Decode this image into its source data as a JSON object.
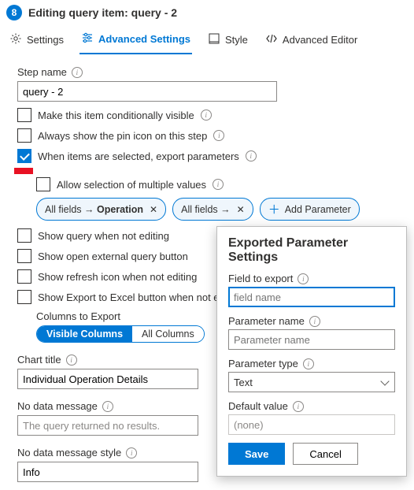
{
  "header": {
    "step_number": "8",
    "title": "Editing query item: query - 2"
  },
  "tabs": {
    "settings": "Settings",
    "advanced": "Advanced Settings",
    "style": "Style",
    "advanced_editor": "Advanced Editor"
  },
  "form": {
    "step_name_label": "Step name",
    "step_name_value": "query - 2",
    "cb_cond_visible": "Make this item conditionally visible",
    "cb_pin_icon": "Always show the pin icon on this step",
    "cb_export_params": "When items are selected, export parameters",
    "cb_multi_values": "Allow selection of multiple values",
    "pill1_prefix": "All fields → ",
    "pill1_bold": "Operation",
    "pill2_text": "All fields →",
    "pill_add": "Add Parameter",
    "cb_show_query": "Show query when not editing",
    "cb_open_external": "Show open external query button",
    "cb_refresh": "Show refresh icon when not editing",
    "cb_export_excel": "Show Export to Excel button when not editing",
    "columns_export_label": "Columns to Export",
    "seg_visible": "Visible Columns",
    "seg_all": "All Columns",
    "chart_title_label": "Chart title",
    "chart_title_value": "Individual Operation Details",
    "no_data_label": "No data message",
    "no_data_value": "The query returned no results.",
    "no_data_style_label": "No data message style",
    "no_data_style_value": "Info"
  },
  "popup": {
    "title": "Exported Parameter Settings",
    "field_export_label": "Field to export",
    "field_export_placeholder": "field name",
    "param_name_label": "Parameter name",
    "param_name_placeholder": "Parameter name",
    "param_type_label": "Parameter type",
    "param_type_value": "Text",
    "default_value_label": "Default value",
    "default_value_value": "(none)",
    "save": "Save",
    "cancel": "Cancel"
  }
}
